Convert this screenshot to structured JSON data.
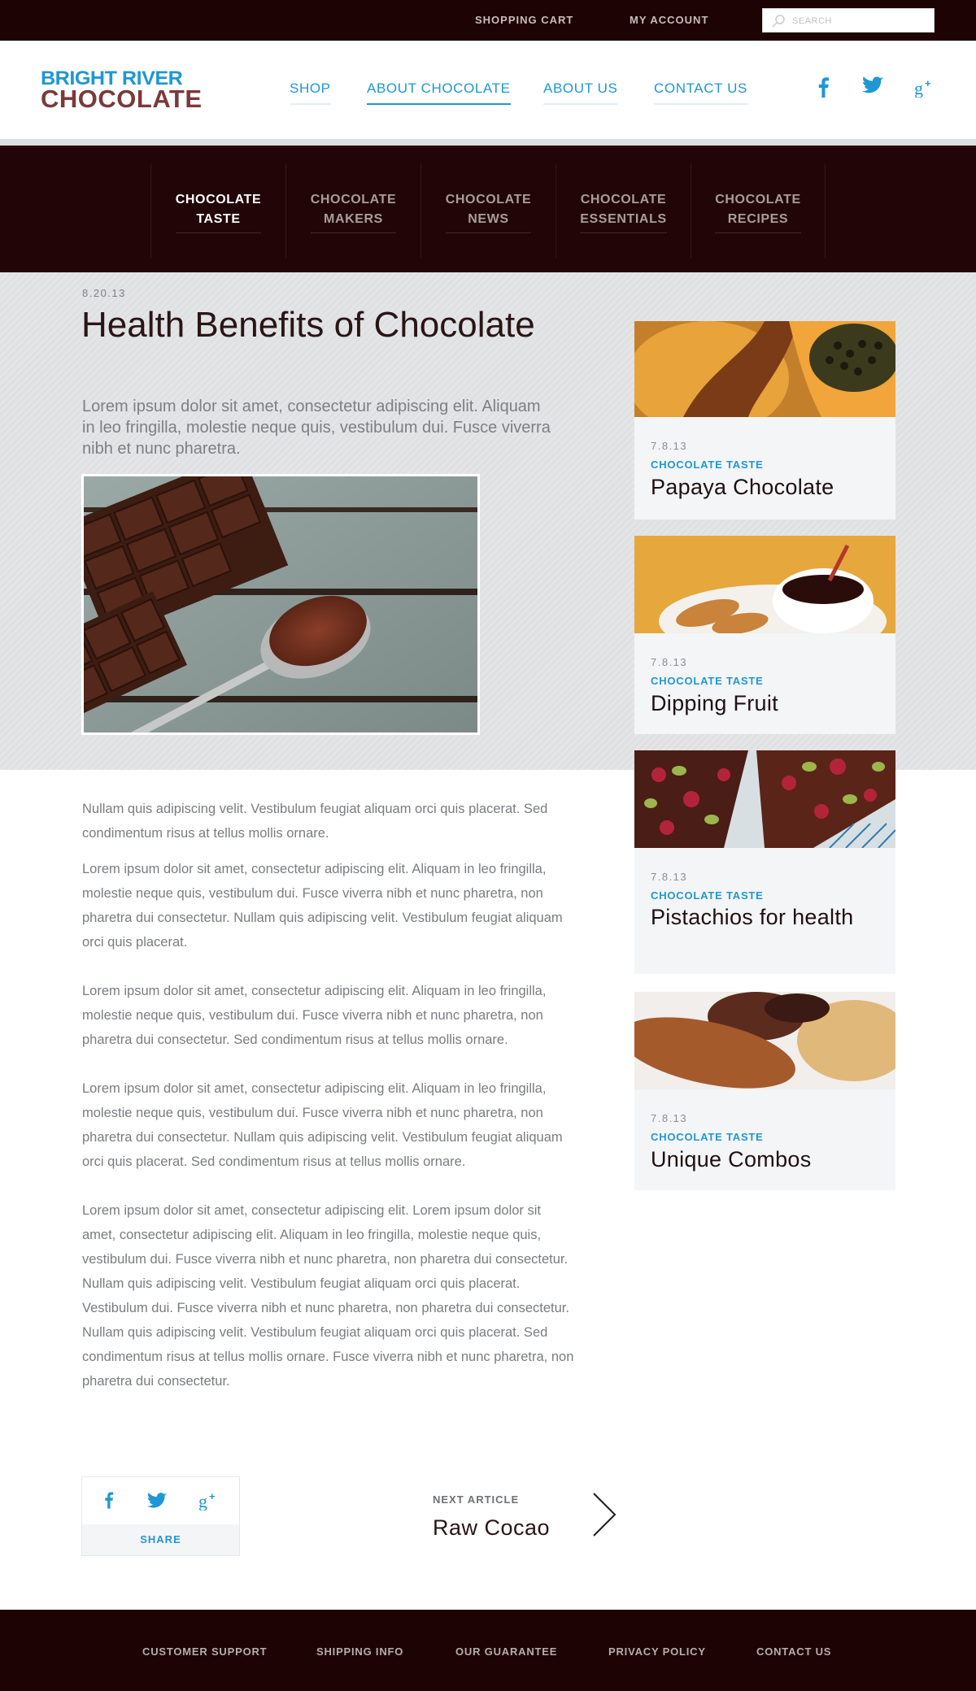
{
  "topbar": {
    "shopping_cart": "SHOPPING CART",
    "my_account": "MY ACCOUNT",
    "search_placeholder": "SEARCH"
  },
  "header": {
    "logo_line1": "BRIGHT RIVER",
    "logo_line2": "CHOCOLATE",
    "nav": [
      "SHOP",
      "ABOUT CHOCOLATE",
      "ABOUT US",
      "CONTACT US"
    ],
    "active_nav": "ABOUT CHOCOLATE",
    "social_icons": [
      "facebook-icon",
      "twitter-icon",
      "google-plus-icon"
    ]
  },
  "subnav": [
    {
      "label": "CHOCOLATE\nTASTE",
      "active": true
    },
    {
      "label": "CHOCOLATE\nMAKERS",
      "active": false
    },
    {
      "label": "CHOCOLATE\nNEWS",
      "active": false
    },
    {
      "label": "CHOCOLATE\nESSENTIALS",
      "active": false
    },
    {
      "label": "CHOCOLATE\nRECIPES",
      "active": false
    }
  ],
  "article": {
    "date": "8.20.13",
    "title": "Health Benefits of Chocolate",
    "lead": "Lorem ipsum dolor sit amet, consectetur adipiscing elit. Aliquam in leo fringilla, molestie neque quis, vestibulum dui. Fusce viverra nibh et nunc pharetra.",
    "paragraphs": [
      "Nullam quis adipiscing velit. Vestibulum feugiat aliquam orci quis placerat. Sed condimentum risus at tellus mollis ornare.",
      "Lorem ipsum dolor sit amet, consectetur adipiscing elit. Aliquam in leo fringilla, molestie neque quis, vestibulum dui. Fusce viverra nibh et nunc pharetra, non pharetra dui consectetur. Nullam quis adipiscing velit. Vestibulum feugiat aliquam orci quis placerat.",
      "Lorem ipsum dolor sit amet, consectetur adipiscing elit. Aliquam in leo fringilla, molestie neque quis, vestibulum dui. Fusce viverra nibh et nunc pharetra, non pharetra dui consectetur. Sed condimentum risus at tellus mollis ornare.",
      "Lorem ipsum dolor sit amet, consectetur adipiscing elit. Aliquam in leo fringilla, molestie neque quis, vestibulum dui. Fusce viverra nibh et nunc pharetra, non pharetra dui consectetur. Nullam quis adipiscing velit. Vestibulum feugiat aliquam orci quis placerat. Sed condimentum risus at tellus mollis ornare.",
      "Lorem ipsum dolor sit amet, consectetur adipiscing elit. Lorem ipsum dolor sit amet, consectetur adipiscing elit. Aliquam in leo fringilla, molestie neque quis, vestibulum dui. Fusce viverra nibh et nunc pharetra, non pharetra dui consectetur. Nullam quis adipiscing velit. Vestibulum feugiat aliquam orci quis placerat. Vestibulum dui. Fusce viverra nibh et nunc pharetra, non pharetra dui consectetur. Nullam quis adipiscing velit. Vestibulum feugiat aliquam orci quis placerat. Sed condimentum risus at tellus mollis ornare. Fusce viverra nibh et nunc pharetra, non pharetra dui consectetur."
    ]
  },
  "share": {
    "label": "SHARE",
    "icons": [
      "facebook-icon",
      "twitter-icon",
      "google-plus-icon"
    ]
  },
  "next_article": {
    "kicker": "NEXT ARTICLE",
    "title": "Raw Cocao"
  },
  "sidebar": [
    {
      "date": "7.8.13",
      "category": "CHOCOLATE TASTE",
      "title": "Papaya Chocolate"
    },
    {
      "date": "7.8.13",
      "category": "CHOCOLATE TASTE",
      "title": "Dipping Fruit"
    },
    {
      "date": "7.8.13",
      "category": "CHOCOLATE TASTE",
      "title": "Pistachios for health"
    },
    {
      "date": "7.8.13",
      "category": "CHOCOLATE TASTE",
      "title": "Unique Combos"
    }
  ],
  "footer": [
    "CUSTOMER SUPPORT",
    "SHIPPING INFO",
    "OUR GUARANTEE",
    "PRIVACY POLICY",
    "CONTACT US"
  ],
  "colors": {
    "dark_brown": "#1d0304",
    "accent_blue": "#1f97d4",
    "logo_brown": "#7a3a3a",
    "card_bg": "#f4f5f7"
  }
}
